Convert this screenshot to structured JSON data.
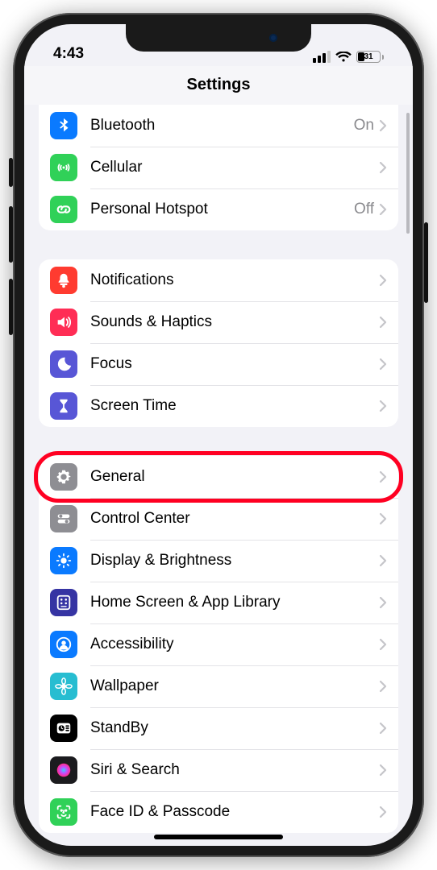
{
  "status": {
    "time": "4:43",
    "battery_pct": "31"
  },
  "nav": {
    "title": "Settings"
  },
  "groups": [
    {
      "rows": [
        {
          "id": "bluetooth",
          "label": "Bluetooth",
          "value": "On",
          "iconColor": "#0a7aff",
          "icon": "bluetooth"
        },
        {
          "id": "cellular",
          "label": "Cellular",
          "value": "",
          "iconColor": "#30d158",
          "icon": "antenna"
        },
        {
          "id": "personal-hotspot",
          "label": "Personal Hotspot",
          "value": "Off",
          "iconColor": "#30d158",
          "icon": "link"
        }
      ]
    },
    {
      "rows": [
        {
          "id": "notifications",
          "label": "Notifications",
          "value": "",
          "iconColor": "#ff3b30",
          "icon": "bell"
        },
        {
          "id": "sounds-haptics",
          "label": "Sounds & Haptics",
          "value": "",
          "iconColor": "#ff2d55",
          "icon": "speaker"
        },
        {
          "id": "focus",
          "label": "Focus",
          "value": "",
          "iconColor": "#5856d6",
          "icon": "moon"
        },
        {
          "id": "screen-time",
          "label": "Screen Time",
          "value": "",
          "iconColor": "#5856d6",
          "icon": "hourglass"
        }
      ]
    },
    {
      "rows": [
        {
          "id": "general",
          "label": "General",
          "value": "",
          "iconColor": "#8e8e93",
          "icon": "gear",
          "highlight": true
        },
        {
          "id": "control-center",
          "label": "Control Center",
          "value": "",
          "iconColor": "#8e8e93",
          "icon": "switches"
        },
        {
          "id": "display",
          "label": "Display & Brightness",
          "value": "",
          "iconColor": "#0a7aff",
          "icon": "sun"
        },
        {
          "id": "home-screen",
          "label": "Home Screen & App Library",
          "value": "",
          "iconColor": "#3634a3",
          "icon": "grid"
        },
        {
          "id": "accessibility",
          "label": "Accessibility",
          "value": "",
          "iconColor": "#0a7aff",
          "icon": "person"
        },
        {
          "id": "wallpaper",
          "label": "Wallpaper",
          "value": "",
          "iconColor": "#27bdd1",
          "icon": "flower"
        },
        {
          "id": "standby",
          "label": "StandBy",
          "value": "",
          "iconColor": "#000000",
          "icon": "clock"
        },
        {
          "id": "siri",
          "label": "Siri & Search",
          "value": "",
          "iconColor": "#1b1b1e",
          "icon": "siri"
        },
        {
          "id": "faceid",
          "label": "Face ID & Passcode",
          "value": "",
          "iconColor": "#30d158",
          "icon": "faceid",
          "cut": true
        }
      ]
    }
  ]
}
